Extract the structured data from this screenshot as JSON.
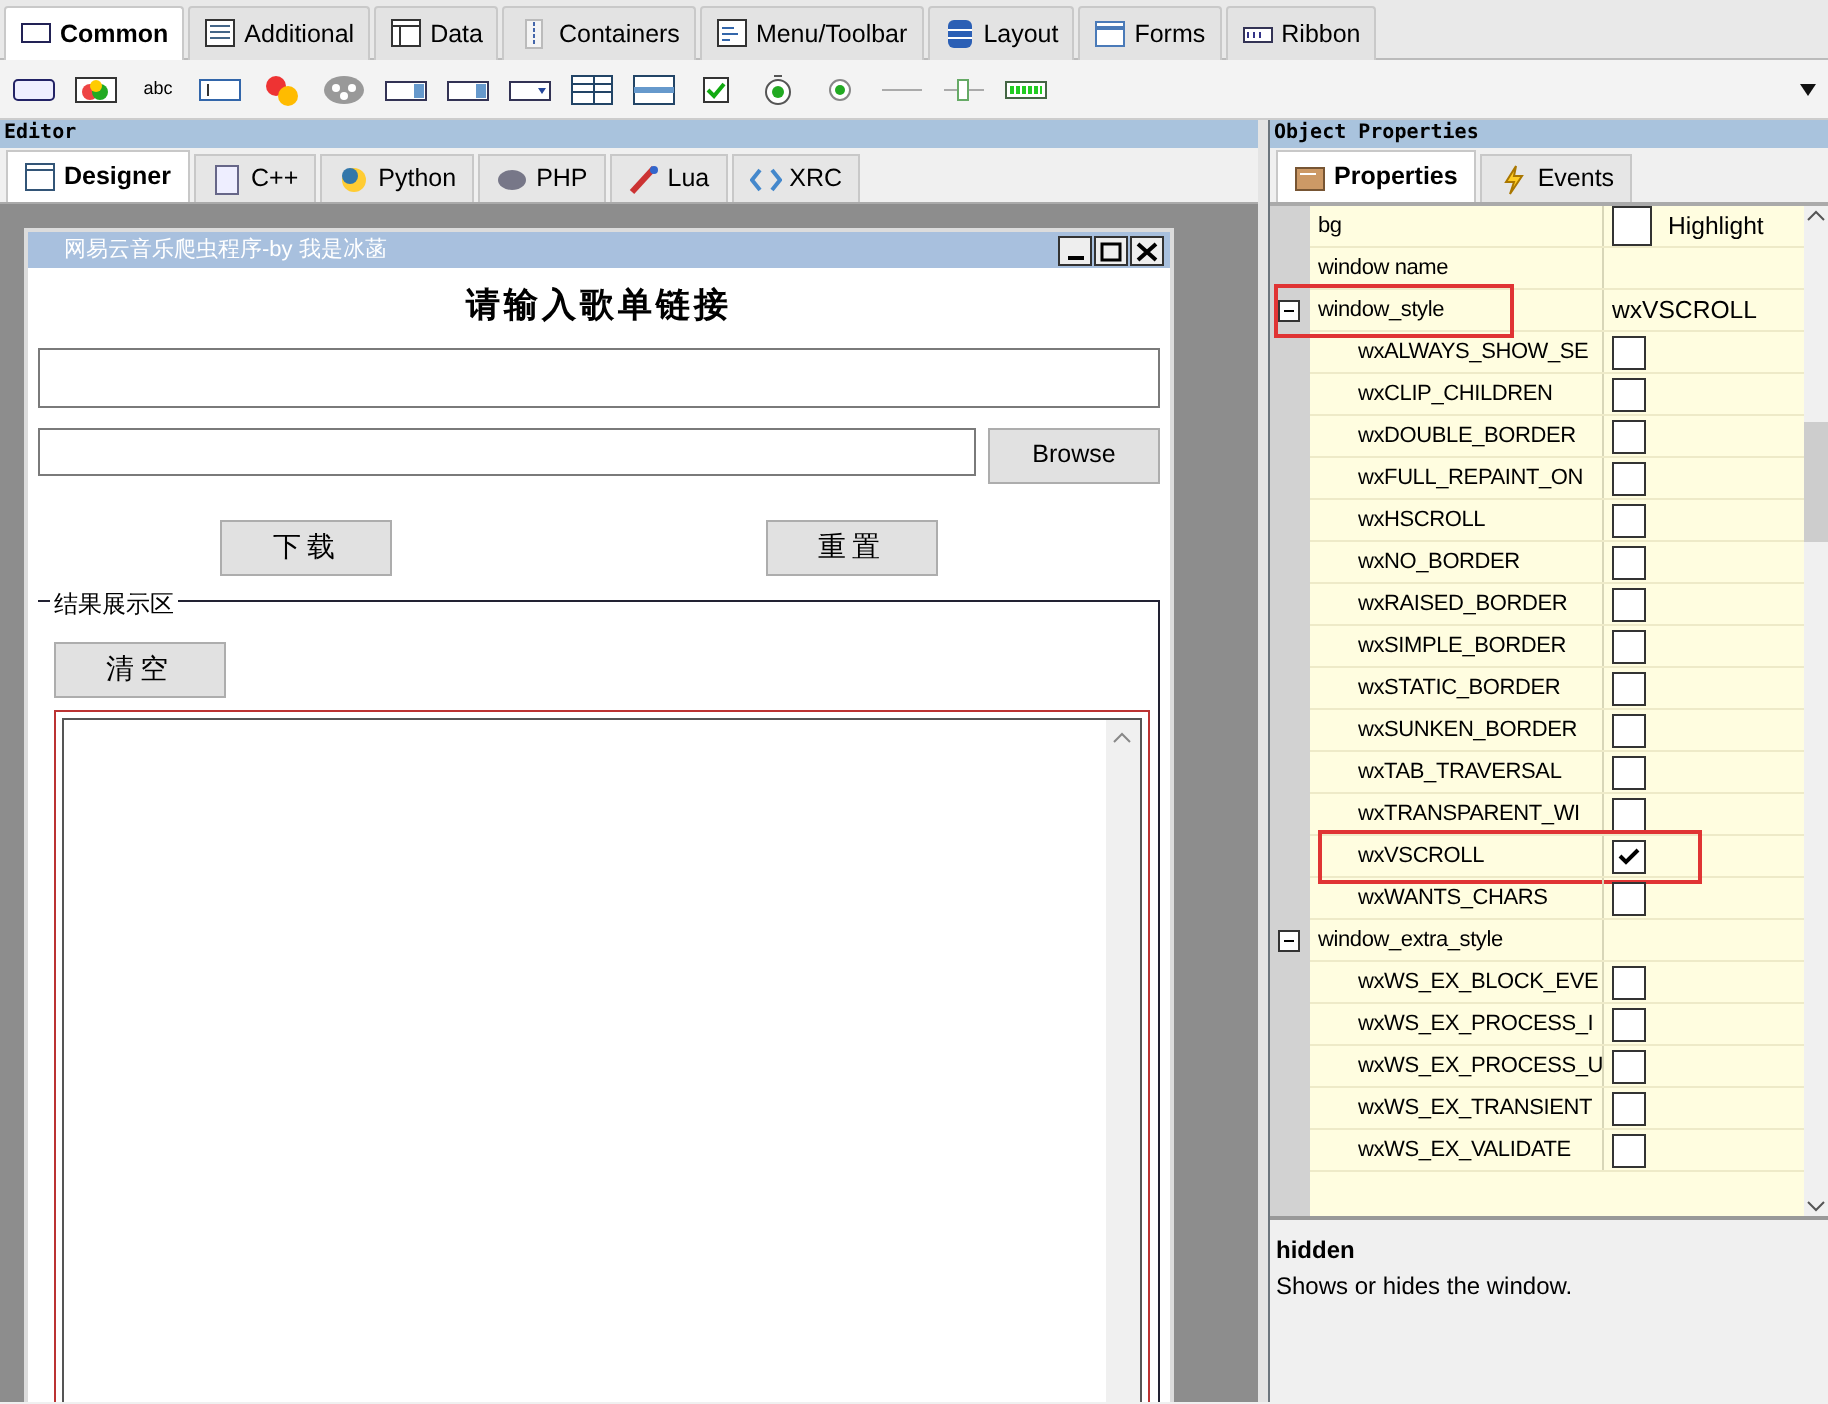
{
  "palette_tabs": [
    {
      "label": "Common",
      "selected": true
    },
    {
      "label": "Additional",
      "selected": false
    },
    {
      "label": "Data",
      "selected": false
    },
    {
      "label": "Containers",
      "selected": false
    },
    {
      "label": "Menu/Toolbar",
      "selected": false
    },
    {
      "label": "Layout",
      "selected": false
    },
    {
      "label": "Forms",
      "selected": false
    },
    {
      "label": "Ribbon",
      "selected": false
    }
  ],
  "toolbar": [
    {
      "kind": "button"
    },
    {
      "kind": "bitmap"
    },
    {
      "kind": "text",
      "label": "abc"
    },
    {
      "kind": "textctrl"
    },
    {
      "kind": "shapes"
    },
    {
      "kind": "reel"
    },
    {
      "kind": "combo"
    },
    {
      "kind": "combo"
    },
    {
      "kind": "choice"
    },
    {
      "kind": "list"
    },
    {
      "kind": "listbox"
    },
    {
      "kind": "check"
    },
    {
      "kind": "radio"
    },
    {
      "kind": "radiodot"
    },
    {
      "kind": "line"
    },
    {
      "kind": "slider"
    },
    {
      "kind": "gauge"
    }
  ],
  "editor": {
    "title": "Editor",
    "tabs": [
      {
        "label": "Designer",
        "selected": true
      },
      {
        "label": "C++",
        "selected": false
      },
      {
        "label": "Python",
        "selected": false
      },
      {
        "label": "PHP",
        "selected": false
      },
      {
        "label": "Lua",
        "selected": false
      },
      {
        "label": "XRC",
        "selected": false
      }
    ],
    "form": {
      "title": "网易云音乐爬虫程序-by 我是冰菡",
      "heading": "请输入歌单链接",
      "browse_button": "Browse",
      "buttons": [
        "下载",
        "重置"
      ],
      "group_label": "结果展示区",
      "clear_button": "清空"
    }
  },
  "properties": {
    "title": "Object Properties",
    "tabs": [
      {
        "label": "Properties",
        "selected": true
      },
      {
        "label": "Events",
        "selected": false
      }
    ],
    "rows": [
      {
        "kind": "color",
        "name": "bg",
        "value": "Highlight"
      },
      {
        "kind": "text",
        "name": "window name"
      },
      {
        "kind": "group",
        "name": "window_style",
        "value": "wxVSCROLL",
        "expanded": true,
        "highlighted": true,
        "children": [
          {
            "kind": "flag",
            "name": "wxALWAYS_SHOW_SE",
            "checked": false,
            "highlighted": false
          },
          {
            "kind": "flag",
            "name": "wxCLIP_CHILDREN",
            "checked": false,
            "highlighted": false
          },
          {
            "kind": "flag",
            "name": "wxDOUBLE_BORDER",
            "checked": false,
            "highlighted": false
          },
          {
            "kind": "flag",
            "name": "wxFULL_REPAINT_ON",
            "checked": false,
            "highlighted": false
          },
          {
            "kind": "flag",
            "name": "wxHSCROLL",
            "checked": false,
            "highlighted": false
          },
          {
            "kind": "flag",
            "name": "wxNO_BORDER",
            "checked": false,
            "highlighted": false
          },
          {
            "kind": "flag",
            "name": "wxRAISED_BORDER",
            "checked": false,
            "highlighted": false
          },
          {
            "kind": "flag",
            "name": "wxSIMPLE_BORDER",
            "checked": false,
            "highlighted": false
          },
          {
            "kind": "flag",
            "name": "wxSTATIC_BORDER",
            "checked": false,
            "highlighted": false
          },
          {
            "kind": "flag",
            "name": "wxSUNKEN_BORDER",
            "checked": false,
            "highlighted": false
          },
          {
            "kind": "flag",
            "name": "wxTAB_TRAVERSAL",
            "checked": false,
            "highlighted": false
          },
          {
            "kind": "flag",
            "name": "wxTRANSPARENT_WI",
            "checked": false,
            "highlighted": false
          },
          {
            "kind": "flag",
            "name": "wxVSCROLL",
            "checked": true,
            "highlighted": true
          },
          {
            "kind": "flag",
            "name": "wxWANTS_CHARS",
            "checked": false,
            "highlighted": false
          }
        ]
      },
      {
        "kind": "group",
        "name": "window_extra_style",
        "expanded": true,
        "highlighted": false,
        "children": [
          {
            "kind": "flag",
            "name": "wxWS_EX_BLOCK_EVE",
            "checked": false,
            "highlighted": false
          },
          {
            "kind": "flag",
            "name": "wxWS_EX_PROCESS_I",
            "checked": false,
            "highlighted": false
          },
          {
            "kind": "flag",
            "name": "wxWS_EX_PROCESS_U",
            "checked": false,
            "highlighted": false
          },
          {
            "kind": "flag",
            "name": "wxWS_EX_TRANSIENT",
            "checked": false,
            "highlighted": false
          },
          {
            "kind": "flag",
            "name": "wxWS_EX_VALIDATE",
            "checked": false,
            "highlighted": false
          }
        ]
      }
    ],
    "description": {
      "name": "hidden",
      "text": "Shows or hides the window."
    }
  }
}
